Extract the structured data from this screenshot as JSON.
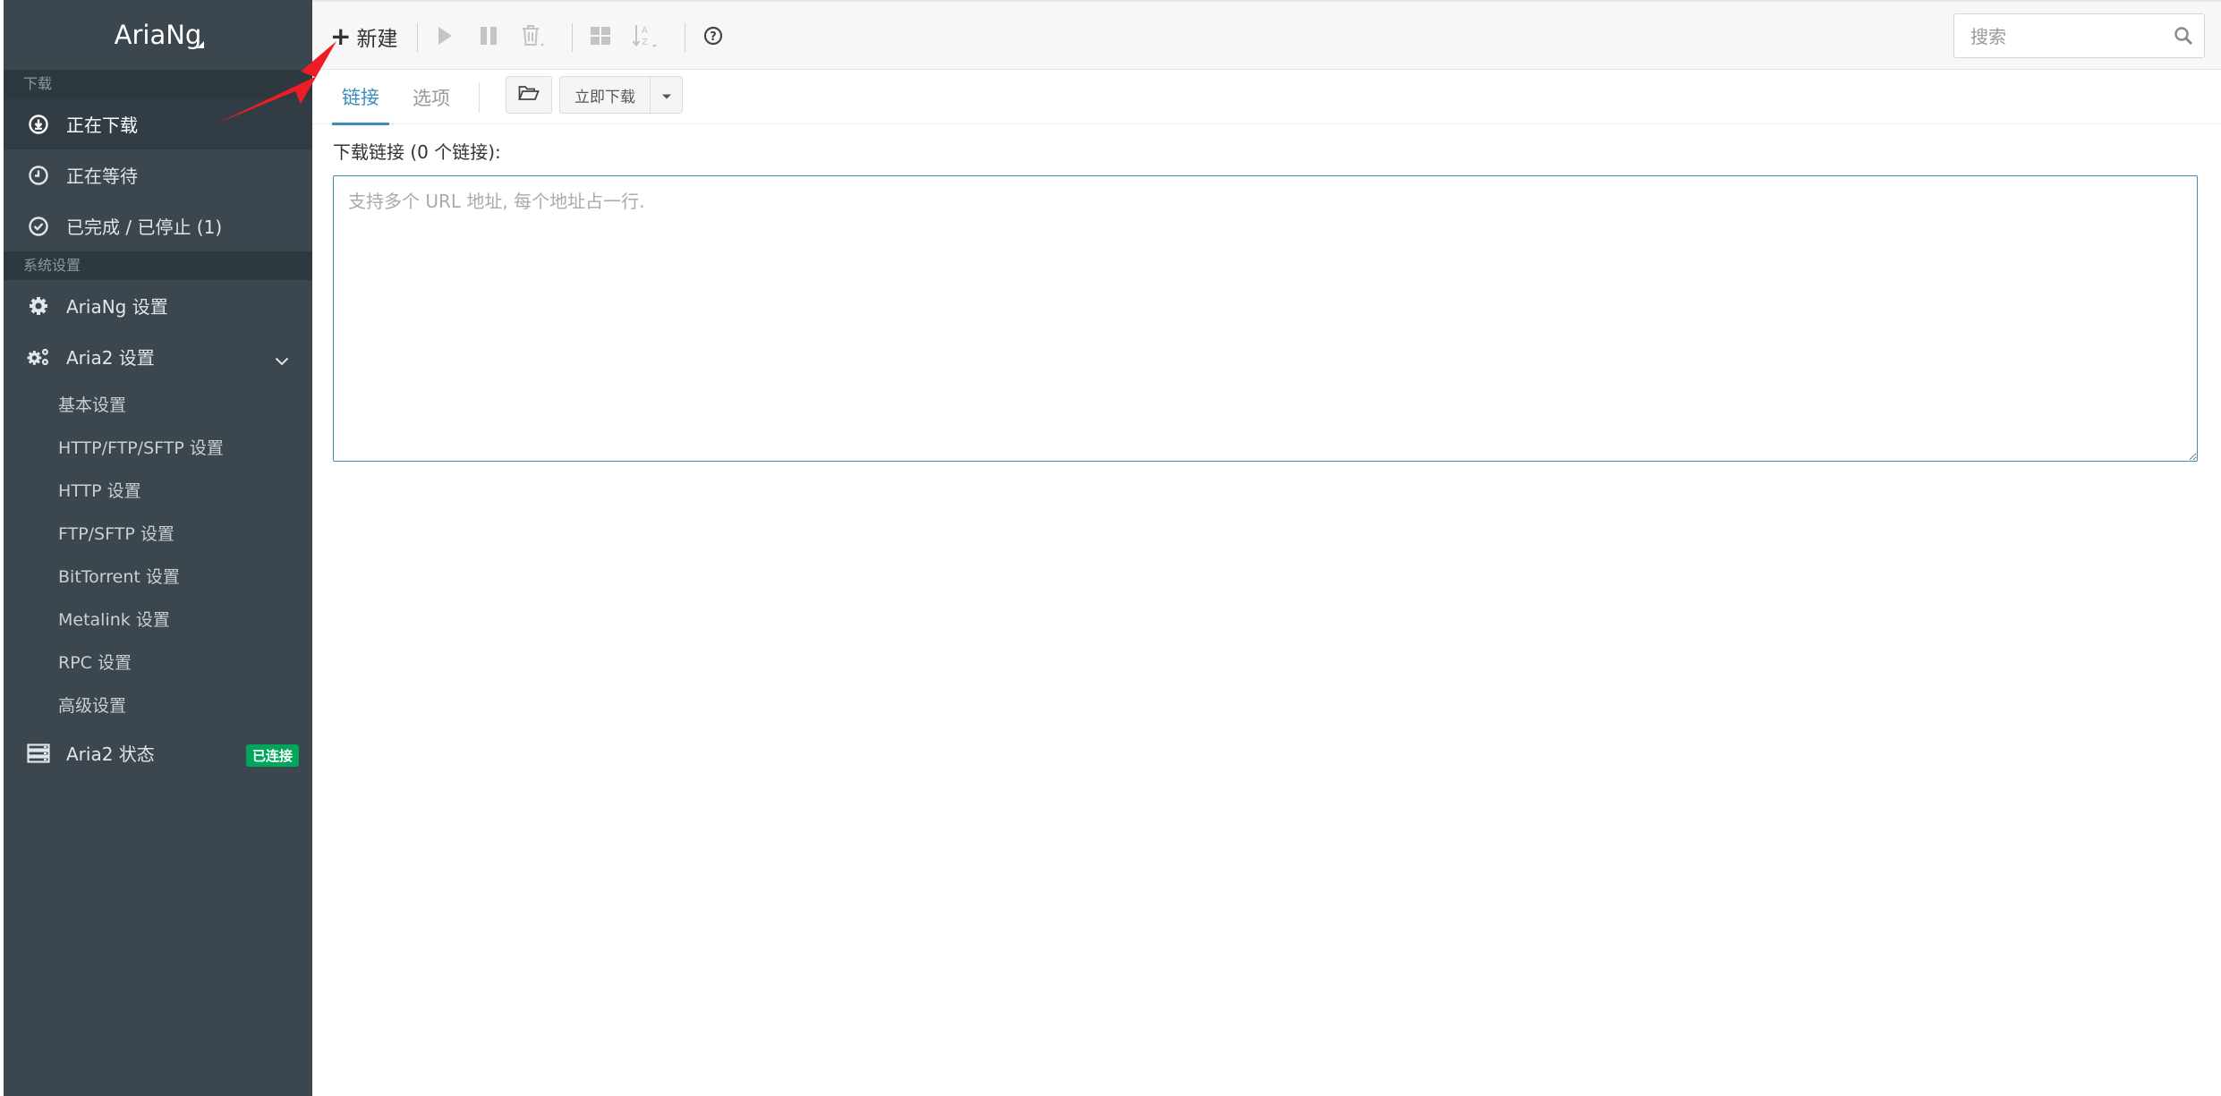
{
  "app": {
    "title": "AriaNg"
  },
  "sidebar": {
    "download_section": "下载",
    "downloading": "正在下载",
    "waiting": "正在等待",
    "stopped": "已完成 / 已停止 (1)",
    "system_section": "系统设置",
    "ariang_settings": "AriaNg 设置",
    "aria2_settings": "Aria2 设置",
    "sub_items": [
      "基本设置",
      "HTTP/FTP/SFTP 设置",
      "HTTP 设置",
      "FTP/SFTP 设置",
      "BitTorrent 设置",
      "Metalink 设置",
      "RPC 设置",
      "高级设置"
    ],
    "aria2_status": "Aria2 状态",
    "connected_badge": "已连接"
  },
  "toolbar": {
    "new_label": "新建",
    "search_placeholder": "搜索"
  },
  "main": {
    "tab_links": "链接",
    "tab_options": "选项",
    "download_now": "立即下载",
    "links_label": "下载链接 (0 个链接):",
    "url_placeholder": "支持多个 URL 地址, 每个地址占一行.",
    "url_value": ""
  },
  "colors": {
    "sidebar_bg": "#3b464f",
    "accent": "#3c8dbc",
    "badge": "#00a65a",
    "arrow": "#ee1c25"
  },
  "icons": [
    "download-icon",
    "clock-icon",
    "check-circle-icon",
    "gear-icon",
    "gears-icon",
    "chevron-down-icon",
    "server-icon",
    "plus-icon",
    "play-icon",
    "pause-icon",
    "trash-icon",
    "grid-icon",
    "sort-icon",
    "help-icon",
    "search-icon",
    "folder-open-icon",
    "caret-down-icon"
  ]
}
